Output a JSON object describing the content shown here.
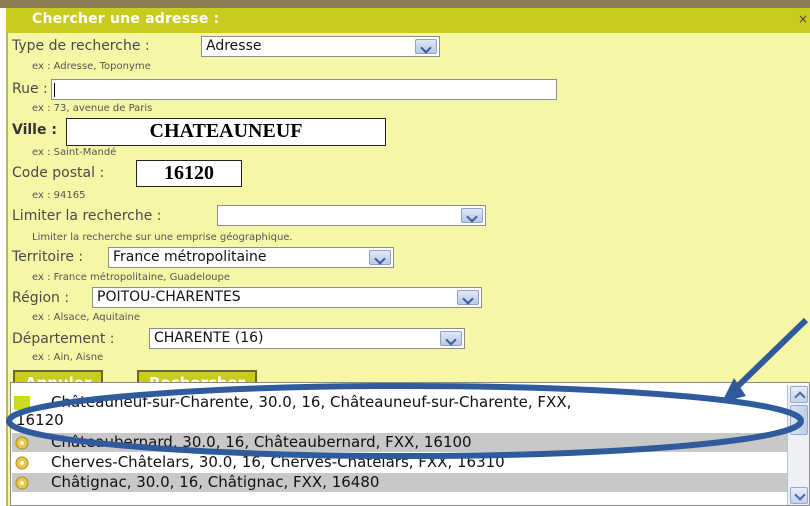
{
  "dialog": {
    "title": "Chercher une adresse :",
    "close": "×"
  },
  "form": {
    "type_recherche": {
      "label": "Type de recherche :",
      "value": "Adresse",
      "hint": "ex : Adresse, Toponyme"
    },
    "rue": {
      "label": "Rue :",
      "value": "",
      "hint": "ex : 73, avenue de Paris"
    },
    "ville": {
      "label": "Ville :",
      "value": "CHATEAUNEUF",
      "hint": "ex : Saint-Mandé"
    },
    "code_postal": {
      "label": "Code postal :",
      "value": "16120",
      "hint": "ex : 94165"
    },
    "limiter": {
      "label": "Limiter la recherche :",
      "value": "",
      "hint": "Limiter la recherche sur une emprise géographique."
    },
    "territoire": {
      "label": "Territoire :",
      "value": "France métropolitaine",
      "hint": "ex : France métropolitaine, Guadeloupe"
    },
    "region": {
      "label": "Région :",
      "value": "POITOU-CHARENTES",
      "hint": "ex : Alsace, Aquitaine"
    },
    "departement": {
      "label": "Département :",
      "value": "CHARENTE (16)",
      "hint": "ex : Ain, Aisne"
    }
  },
  "buttons": {
    "cancel": "Annuler",
    "search": "Rechercher"
  },
  "results": [
    {
      "line1": "Châteauneuf-sur-Charente, 30.0, 16, Châteauneuf-sur-Charente, FXX,",
      "line2": "16120"
    },
    {
      "line1": "Châteaubernard, 30.0, 16, Châteaubernard, FXX, 16100"
    },
    {
      "line1": "Cherves-Châtelars, 30.0, 16, Cherves-Châtelars, FXX, 16310"
    },
    {
      "line1": "Châtignac, 30.0, 16, Châtignac, FXX, 16480"
    }
  ],
  "colors": {
    "panel": "#f6f7a6",
    "header": "#c9cc1c",
    "annotation": "#2f5b9c",
    "selected_marker": "#c8dc1a",
    "row_gray": "#c8c8c8"
  }
}
